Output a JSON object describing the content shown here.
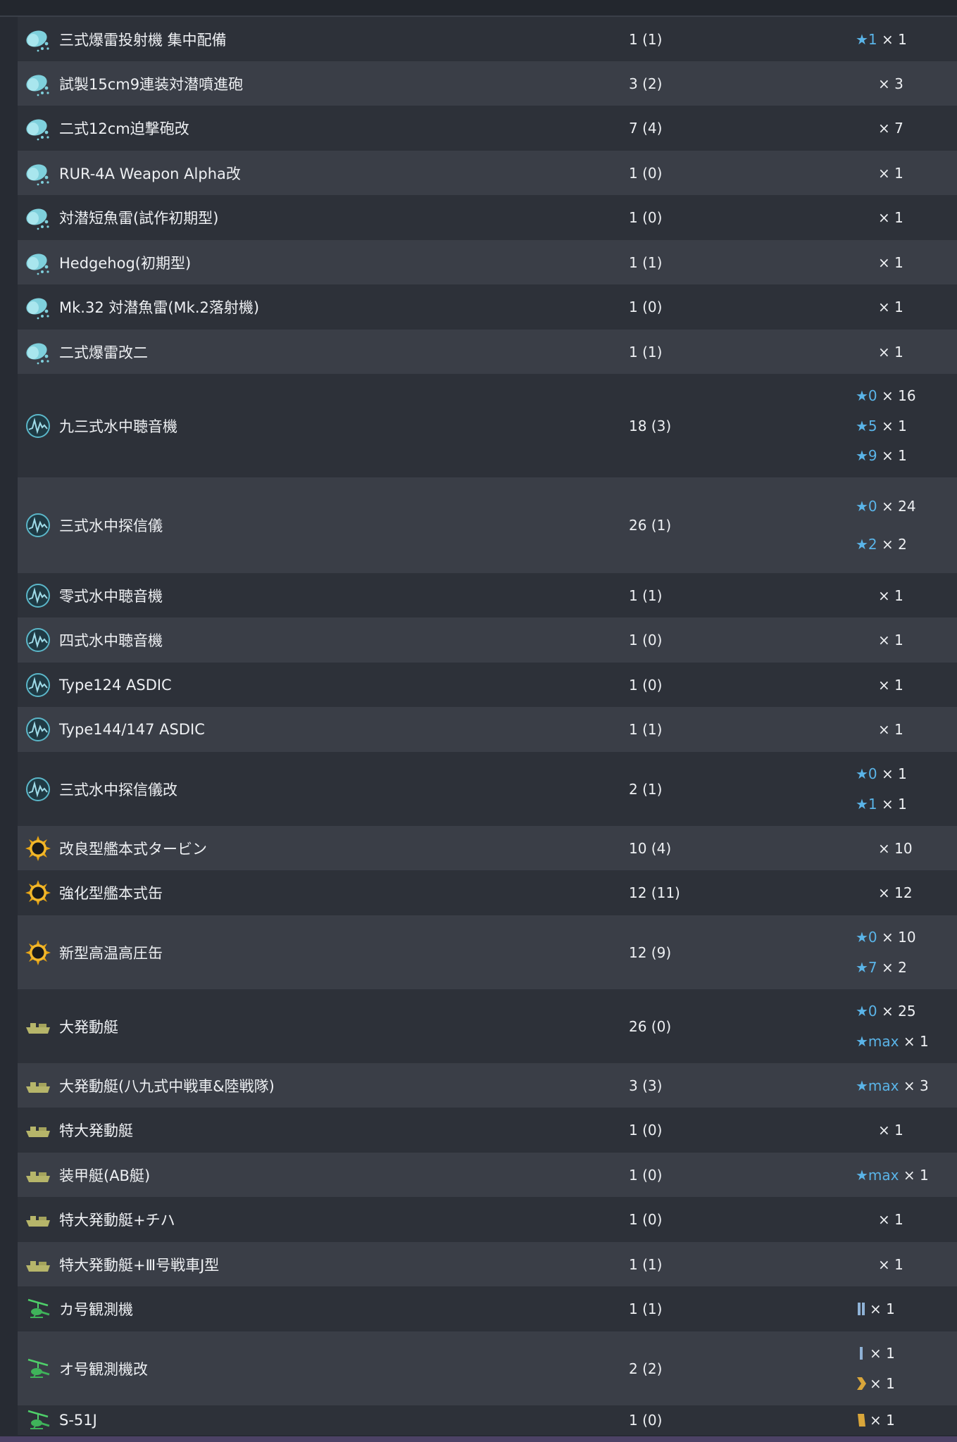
{
  "rows": [
    {
      "icon": "depth-charge-icon",
      "name": "三式爆雷投射機 集中配備",
      "count": "1 (1)",
      "imps": [
        {
          "star": "★1",
          "qty": "× 1"
        }
      ]
    },
    {
      "icon": "depth-charge-icon",
      "name": "試製15cm9連装対潜噴進砲",
      "count": "3 (2)",
      "imps": [
        {
          "star": "",
          "qty": "× 3"
        }
      ]
    },
    {
      "icon": "depth-charge-icon",
      "name": "二式12cm迫撃砲改",
      "count": "7 (4)",
      "imps": [
        {
          "star": "",
          "qty": "× 7"
        }
      ]
    },
    {
      "icon": "depth-charge-icon",
      "name": "RUR-4A Weapon Alpha改",
      "count": "1 (0)",
      "imps": [
        {
          "star": "",
          "qty": "× 1"
        }
      ]
    },
    {
      "icon": "depth-charge-icon",
      "name": "対潜短魚雷(試作初期型)",
      "count": "1 (0)",
      "imps": [
        {
          "star": "",
          "qty": "× 1"
        }
      ]
    },
    {
      "icon": "depth-charge-icon",
      "name": "Hedgehog(初期型)",
      "count": "1 (1)",
      "imps": [
        {
          "star": "",
          "qty": "× 1"
        }
      ]
    },
    {
      "icon": "depth-charge-icon",
      "name": "Mk.32 対潜魚雷(Mk.2落射機)",
      "count": "1 (0)",
      "imps": [
        {
          "star": "",
          "qty": "× 1"
        }
      ]
    },
    {
      "icon": "depth-charge-icon",
      "name": "二式爆雷改二",
      "count": "1 (1)",
      "imps": [
        {
          "star": "",
          "qty": "× 1"
        }
      ]
    },
    {
      "icon": "sonar-icon",
      "name": "九三式水中聴音機",
      "count": "18 (3)",
      "imps": [
        {
          "star": "★0",
          "qty": "× 16"
        },
        {
          "star": "★5",
          "qty": "× 1"
        },
        {
          "star": "★9",
          "qty": "× 1"
        }
      ]
    },
    {
      "icon": "sonar-icon",
      "name": "三式水中探信儀",
      "count": "26 (1)",
      "imps": [
        {
          "star": "★0",
          "qty": "× 24"
        },
        {
          "star": "★2",
          "qty": "× 2"
        }
      ]
    },
    {
      "icon": "sonar-icon",
      "name": "零式水中聴音機",
      "count": "1 (1)",
      "imps": [
        {
          "star": "",
          "qty": "× 1"
        }
      ]
    },
    {
      "icon": "sonar-icon",
      "name": "四式水中聴音機",
      "count": "1 (0)",
      "imps": [
        {
          "star": "",
          "qty": "× 1"
        }
      ]
    },
    {
      "icon": "sonar-icon",
      "name": "Type124 ASDIC",
      "count": "1 (0)",
      "imps": [
        {
          "star": "",
          "qty": "× 1"
        }
      ]
    },
    {
      "icon": "sonar-icon",
      "name": "Type144/147 ASDIC",
      "count": "1 (1)",
      "imps": [
        {
          "star": "",
          "qty": "× 1"
        }
      ]
    },
    {
      "icon": "sonar-icon",
      "name": "三式水中探信儀改",
      "count": "2 (1)",
      "imps": [
        {
          "star": "★0",
          "qty": "× 1"
        },
        {
          "star": "★1",
          "qty": "× 1"
        }
      ]
    },
    {
      "icon": "engine-icon",
      "name": "改良型艦本式タービン",
      "count": "10 (4)",
      "imps": [
        {
          "star": "",
          "qty": "× 10"
        }
      ]
    },
    {
      "icon": "engine-icon",
      "name": "強化型艦本式缶",
      "count": "12 (11)",
      "imps": [
        {
          "star": "",
          "qty": "× 12"
        }
      ]
    },
    {
      "icon": "engine-icon",
      "name": "新型高温高圧缶",
      "count": "12 (9)",
      "imps": [
        {
          "star": "★0",
          "qty": "× 10"
        },
        {
          "star": "★7",
          "qty": "× 2"
        }
      ]
    },
    {
      "icon": "landing-craft-icon",
      "name": "大発動艇",
      "count": "26 (0)",
      "imps": [
        {
          "star": "★0",
          "qty": "× 25"
        },
        {
          "star": "★max",
          "qty": "× 1"
        }
      ]
    },
    {
      "icon": "landing-craft-icon",
      "name": "大発動艇(八九式中戦車&陸戦隊)",
      "count": "3 (3)",
      "imps": [
        {
          "star": "★max",
          "qty": "× 3"
        }
      ]
    },
    {
      "icon": "landing-craft-icon",
      "name": "特大発動艇",
      "count": "1 (0)",
      "imps": [
        {
          "star": "",
          "qty": "× 1"
        }
      ]
    },
    {
      "icon": "landing-craft-icon",
      "name": "装甲艇(AB艇)",
      "count": "1 (0)",
      "imps": [
        {
          "star": "★max",
          "qty": "× 1"
        }
      ]
    },
    {
      "icon": "landing-craft-icon",
      "name": "特大発動艇+チハ",
      "count": "1 (0)",
      "imps": [
        {
          "star": "",
          "qty": "× 1"
        }
      ]
    },
    {
      "icon": "landing-craft-icon",
      "name": "特大発動艇+Ⅲ号戦車J型",
      "count": "1 (1)",
      "imps": [
        {
          "star": "",
          "qty": "× 1"
        }
      ]
    },
    {
      "icon": "autogyro-icon",
      "name": "カ号観測機",
      "count": "1 (1)",
      "imps": [
        {
          "star": "",
          "prof": "prof-2-icon",
          "qty": "× 1"
        }
      ]
    },
    {
      "icon": "autogyro-icon",
      "name": "オ号観測機改",
      "count": "2 (2)",
      "imps": [
        {
          "star": "",
          "prof": "prof-1-icon",
          "qty": "× 1"
        },
        {
          "star": "",
          "prof": "prof-chevron-icon",
          "qty": "× 1"
        }
      ]
    },
    {
      "icon": "autogyro-icon",
      "name": "S-51J",
      "count": "1 (0)",
      "imps": [
        {
          "star": "",
          "prof": "prof-gold-icon",
          "qty": "× 1"
        }
      ]
    }
  ]
}
